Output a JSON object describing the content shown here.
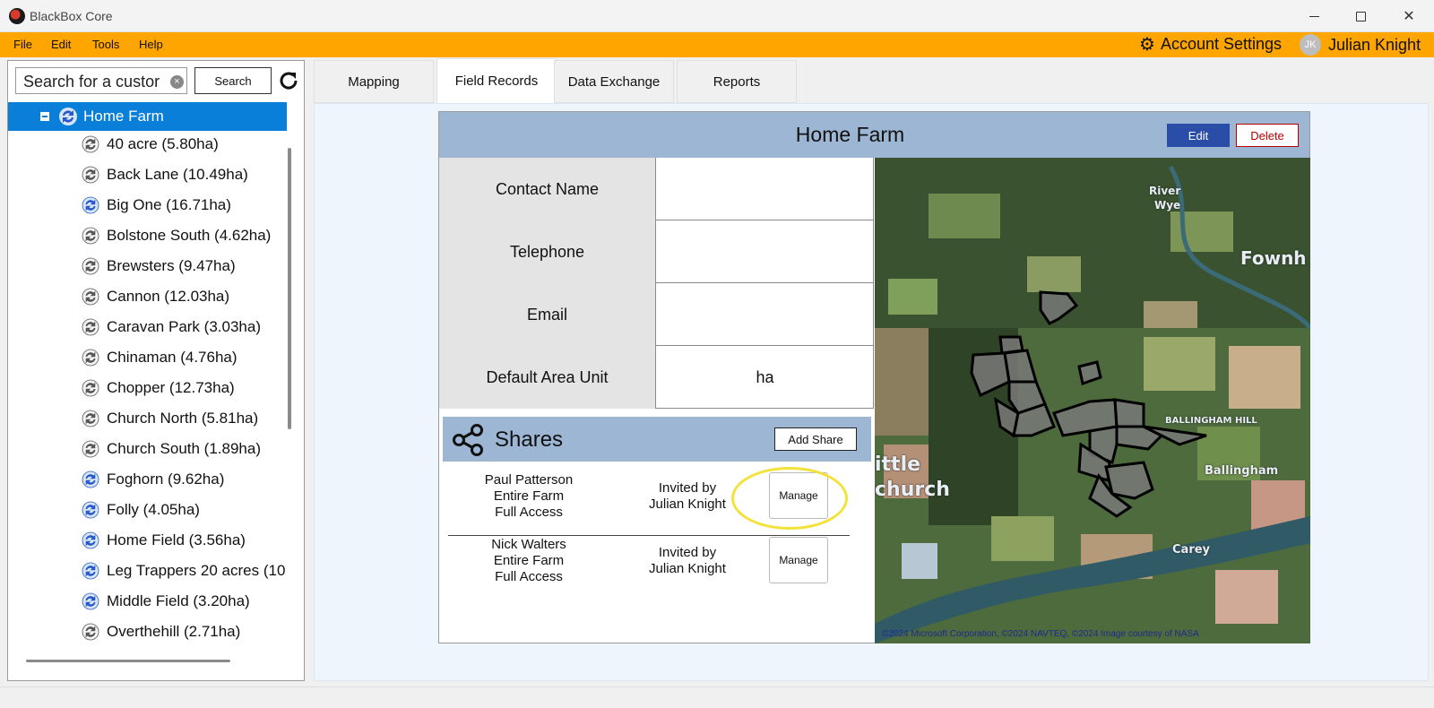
{
  "window": {
    "title": "BlackBox Core"
  },
  "menu": {
    "items": [
      "File",
      "Edit",
      "Tools",
      "Help"
    ],
    "account_settings": "Account Settings",
    "user_initials": "JK",
    "user_name": "Julian Knight"
  },
  "search": {
    "value": "Search for a custor",
    "button": "Search"
  },
  "tree": {
    "selected": "Home Farm",
    "fields": [
      {
        "label": "40 acre (5.80ha)",
        "synced": false
      },
      {
        "label": "Back Lane (10.49ha)",
        "synced": false
      },
      {
        "label": "Big One (16.71ha)",
        "synced": true
      },
      {
        "label": "Bolstone South (4.62ha)",
        "synced": false
      },
      {
        "label": "Brewsters (9.47ha)",
        "synced": false
      },
      {
        "label": "Cannon (12.03ha)",
        "synced": false
      },
      {
        "label": "Caravan Park (3.03ha)",
        "synced": false
      },
      {
        "label": "Chinaman (4.76ha)",
        "synced": false
      },
      {
        "label": "Chopper (12.73ha)",
        "synced": false
      },
      {
        "label": "Church North (5.81ha)",
        "synced": false
      },
      {
        "label": "Church South (1.89ha)",
        "synced": false
      },
      {
        "label": "Foghorn (9.62ha)",
        "synced": true
      },
      {
        "label": "Folly (4.05ha)",
        "synced": true
      },
      {
        "label": "Home Field (3.56ha)",
        "synced": true
      },
      {
        "label": "Leg Trappers 20 acres (10",
        "synced": true
      },
      {
        "label": "Middle Field (3.20ha)",
        "synced": true
      },
      {
        "label": "Overthehill (2.71ha)",
        "synced": false
      }
    ]
  },
  "tabs": [
    {
      "label": "Mapping",
      "active": false
    },
    {
      "label": "Field Records",
      "active": true
    },
    {
      "label": "Data Exchange",
      "active": false
    },
    {
      "label": "Reports",
      "active": false
    }
  ],
  "farm": {
    "title": "Home Farm",
    "edit": "Edit",
    "delete": "Delete",
    "rows": [
      {
        "label": "Contact Name",
        "value": ""
      },
      {
        "label": "Telephone",
        "value": ""
      },
      {
        "label": "Email",
        "value": ""
      },
      {
        "label": "Default Area Unit",
        "value": "ha"
      }
    ]
  },
  "shares": {
    "title": "Shares",
    "add_button": "Add Share",
    "entries": [
      {
        "name": "Paul Patterson",
        "scope": "Entire Farm",
        "access": "Full Access",
        "invited_line1": "Invited by",
        "invited_line2": "Julian Knight",
        "manage": "Manage"
      },
      {
        "name": "Nick Walters",
        "scope": "Entire Farm",
        "access": "Full Access",
        "invited_line1": "Invited by",
        "invited_line2": "Julian Knight",
        "manage": "Manage"
      }
    ]
  },
  "map": {
    "labels": [
      "River",
      "Wye",
      "Fownh",
      "BALLINGHAM HILL",
      "Ballingham",
      "ittle",
      "church",
      "Carey"
    ],
    "credit": "©2024 Microsoft Corporation, ©2024 NAVTEQ, ©2024 Image courtesy of NASA"
  },
  "colors": {
    "accent": "#ffa500",
    "selection": "#0a7fd9",
    "header_blue": "#9db6d4",
    "edit_blue": "#2a4ea7",
    "delete_red": "#b40000",
    "highlight": "#f3e23a"
  }
}
